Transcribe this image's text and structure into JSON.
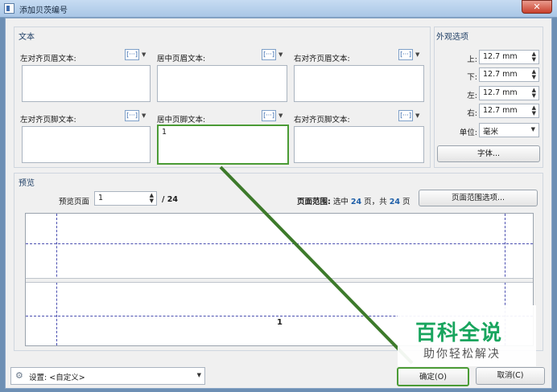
{
  "window": {
    "title": "添加贝茨编号",
    "close_label": "✕"
  },
  "text_section": {
    "title": "文本",
    "header_left_label": "左对齐页眉文本:",
    "header_center_label": "居中页眉文本:",
    "header_right_label": "右对齐页眉文本:",
    "footer_left_label": "左对齐页脚文本:",
    "footer_center_label": "居中页脚文本:",
    "footer_right_label": "右对齐页脚文本:",
    "insert_button_label": "[···]",
    "header_left_value": "",
    "header_center_value": "",
    "header_right_value": "",
    "footer_left_value": "",
    "footer_center_value": "1",
    "footer_right_value": ""
  },
  "appearance": {
    "title": "外观选项",
    "top_label": "上:",
    "top_value": "12.7 mm",
    "bottom_label": "下:",
    "bottom_value": "12.7 mm",
    "left_label": "左:",
    "left_value": "12.7 mm",
    "right_label": "右:",
    "right_value": "12.7 mm",
    "unit_label": "单位:",
    "unit_value": "毫米",
    "font_button": "字体..."
  },
  "preview": {
    "title": "预览",
    "page_label": "预览页面",
    "page_value": "1",
    "page_total": "/ 24",
    "range_label": "页面范围:",
    "range_text_1": "选中",
    "range_selected": "24",
    "range_text_2": "页，共",
    "range_total": "24",
    "range_text_3": "页",
    "range_button": "页面范围选项...",
    "footer_sample": "1"
  },
  "footer": {
    "settings_label": "设置:",
    "settings_value": "<自定义>",
    "ok_button": "确定(O)",
    "cancel_button": "取消(C)"
  },
  "watermark": {
    "main": "百科全说",
    "sub": "助你轻松解决"
  },
  "colors": {
    "accent_green": "#4a9b35",
    "margin_line": "#4a4fb0",
    "watermark_green": "#19a55e"
  }
}
